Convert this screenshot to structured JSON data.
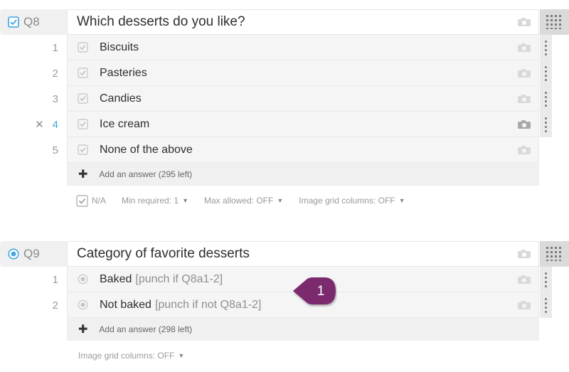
{
  "q8": {
    "number": "Q8",
    "type_icon": "checkbox-icon",
    "title": "Which desserts do you like?",
    "answers": [
      {
        "num": "1",
        "label": "Biscuits"
      },
      {
        "num": "2",
        "label": "Pasteries"
      },
      {
        "num": "3",
        "label": "Candies"
      },
      {
        "num": "4",
        "label": "Ice cream",
        "active": true
      },
      {
        "num": "5",
        "label": "None of the above"
      }
    ],
    "add_answer": "Add an answer (295 left)",
    "options": {
      "na": "N/A",
      "min_required": "Min required: 1",
      "max_allowed": "Max allowed: OFF",
      "image_grid": "Image grid columns: OFF"
    }
  },
  "q9": {
    "number": "Q9",
    "type_icon": "radio-icon",
    "title": "Category of favorite desserts",
    "answers": [
      {
        "num": "1",
        "label": "Baked",
        "punch": "[punch if Q8a1-2]"
      },
      {
        "num": "2",
        "label": "Not baked",
        "punch": "[punch if not Q8a1-2]"
      }
    ],
    "add_answer": "Add an answer (298 left)",
    "options": {
      "image_grid": "Image grid columns: OFF"
    }
  },
  "callout": {
    "label": "1",
    "color": "#7b2a6e"
  },
  "colors": {
    "accent": "#3fa4e0",
    "grid_button": "#dadada"
  }
}
